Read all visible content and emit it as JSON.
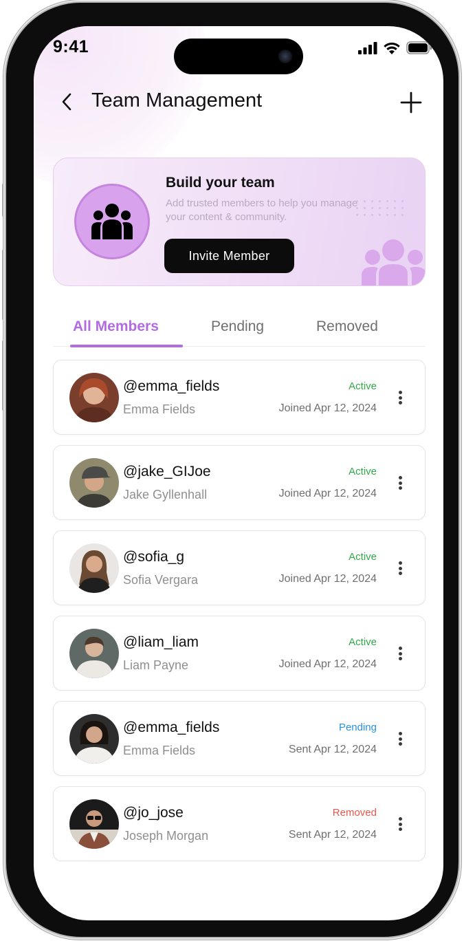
{
  "status_bar": {
    "time": "9:41"
  },
  "header": {
    "title": "Team Management"
  },
  "banner": {
    "title": "Build your team",
    "subtitle": "Add trusted members to help you manage your content & community.",
    "button_label": "Invite Member"
  },
  "tabs": [
    {
      "label": "All Members"
    },
    {
      "label": "Pending"
    },
    {
      "label": "Removed"
    }
  ],
  "colors": {
    "accent": "#b26be0",
    "active": "#31a84a",
    "pending": "#2a92dc",
    "removed": "#e9564b"
  },
  "members": [
    {
      "handle": "@emma_fields",
      "name": "Emma Fields",
      "status": "Active",
      "date": "Joined Apr 12, 2024"
    },
    {
      "handle": "@jake_GIJoe",
      "name": "Jake Gyllenhall",
      "status": "Active",
      "date": "Joined Apr 12, 2024"
    },
    {
      "handle": "@sofia_g",
      "name": "Sofia Vergara",
      "status": "Active",
      "date": "Joined Apr 12, 2024"
    },
    {
      "handle": "@liam_liam",
      "name": "Liam Payne",
      "status": "Active",
      "date": "Joined Apr 12, 2024"
    },
    {
      "handle": "@emma_fields",
      "name": "Emma Fields",
      "status": "Pending",
      "date": "Sent Apr 12, 2024"
    },
    {
      "handle": "@jo_jose",
      "name": "Joseph Morgan",
      "status": "Removed",
      "date": "Sent Apr 12, 2024"
    }
  ]
}
